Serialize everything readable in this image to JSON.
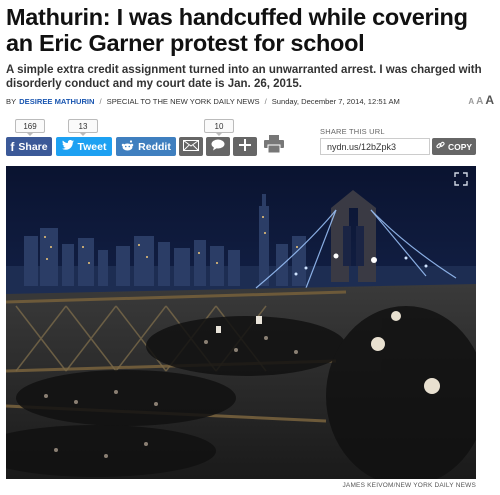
{
  "article": {
    "headline": "Mathurin: I was handcuffed while covering an Eric Garner protest for school",
    "dek": "A simple extra credit assignment turned into an unwarranted arrest. I was charged with disorderly conduct and my court date is Jan. 26, 2015.",
    "byline": {
      "prefix": "BY",
      "author": "DESIREE MATHURIN",
      "section": "SPECIAL TO THE NEW YORK DAILY NEWS",
      "date": "Sunday, December 7, 2014, 12:51 AM",
      "separator": "/"
    },
    "text_size_controls": [
      "A",
      "A",
      "A"
    ]
  },
  "share": {
    "counts": {
      "facebook": "169",
      "twitter": "13",
      "email": "10"
    },
    "facebook_label": "Share",
    "twitter_label": "Tweet",
    "reddit_label": "Reddit",
    "share_url_label": "SHARE THIS URL",
    "share_url": "nydn.us/12bZpk3",
    "copy_label": "COPY",
    "icons": [
      "email-icon",
      "comment-icon",
      "plus-icon",
      "print-icon"
    ]
  },
  "photo": {
    "credit": "JAMES KEIVOM/NEW YORK DAILY NEWS",
    "expand_icon": "expand-icon"
  },
  "colors": {
    "facebook": "#3b5998",
    "twitter": "#1da1f2",
    "reddit": "#3f7fbf",
    "gray_button": "#666666",
    "author_link": "#1a56b0"
  }
}
